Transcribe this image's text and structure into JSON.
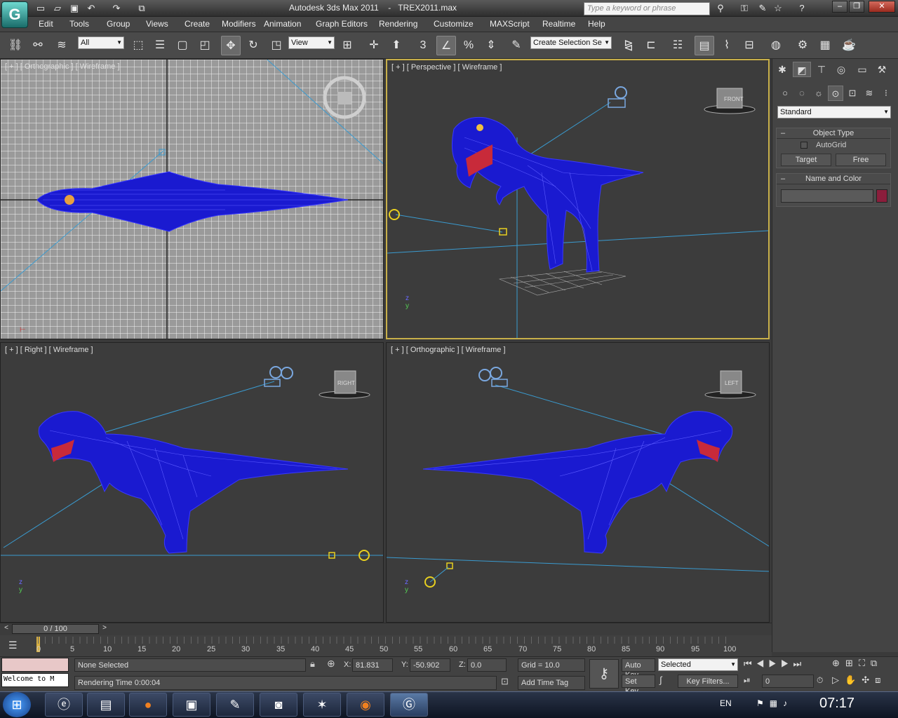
{
  "app": {
    "logo": "G",
    "title": "Autodesk 3ds Max 2011",
    "file": "TREX2011.max"
  },
  "quick_access": [
    "new-icon",
    "open-icon",
    "save-icon",
    "undo-icon",
    "redo-icon",
    "project-icon"
  ],
  "search": {
    "placeholder": "Type a keyword or phrase"
  },
  "menu": [
    "Edit",
    "Tools",
    "Group",
    "Views",
    "Create",
    "Modifiers",
    "Animation",
    "Graph Editors",
    "Rendering",
    "Customize",
    "MAXScript",
    "Realtime",
    "Help"
  ],
  "toolbar": {
    "filter": "All",
    "ref_coord": "View",
    "named_set": "Create Selection Se",
    "snap_label": "3"
  },
  "viewports": {
    "top_left": "[ + ] [ Orthographic ] [ Wireframe ]",
    "top_right": "[ + ] [ Perspective ] [ Wireframe ]",
    "bottom_left": "[ + ] [ Right ] [ Wireframe ]",
    "bottom_right": "[ + ] [ Orthographic ] [ Wireframe ]",
    "viewcube_right": "RIGHT",
    "viewcube_left": "LEFT",
    "viewcube_front": "FRONT",
    "axis_z": "z",
    "axis_y": "y"
  },
  "command_panel": {
    "dropdown": "Standard",
    "object_type": {
      "title": "Object Type",
      "autogrid": "AutoGrid",
      "buttons": [
        "Target",
        "Free"
      ]
    },
    "name_color": {
      "title": "Name and Color",
      "name_value": "",
      "color": "#8b1e3c"
    }
  },
  "timeline": {
    "frame": "0 / 100",
    "ticks": [
      "0",
      "5",
      "10",
      "15",
      "20",
      "25",
      "30",
      "35",
      "40",
      "45",
      "50",
      "55",
      "60",
      "65",
      "70",
      "75",
      "80",
      "85",
      "90",
      "95",
      "100"
    ]
  },
  "status": {
    "maxscript": "Welcome to M",
    "selection": "None Selected",
    "prompt": "Rendering Time  0:00:04",
    "x_label": "X:",
    "x": "81.831",
    "y_label": "Y:",
    "y": "-50.902",
    "z_label": "Z:",
    "z": "0.0",
    "grid": "Grid = 10.0",
    "add_time_tag": "Add Time Tag",
    "auto_key": "Auto Key",
    "set_key": "Set Key",
    "key_mode": "Selected",
    "key_filters": "Key Filters...",
    "frame_field": "0"
  },
  "taskbar": {
    "lang": "EN",
    "time": "07:17"
  }
}
